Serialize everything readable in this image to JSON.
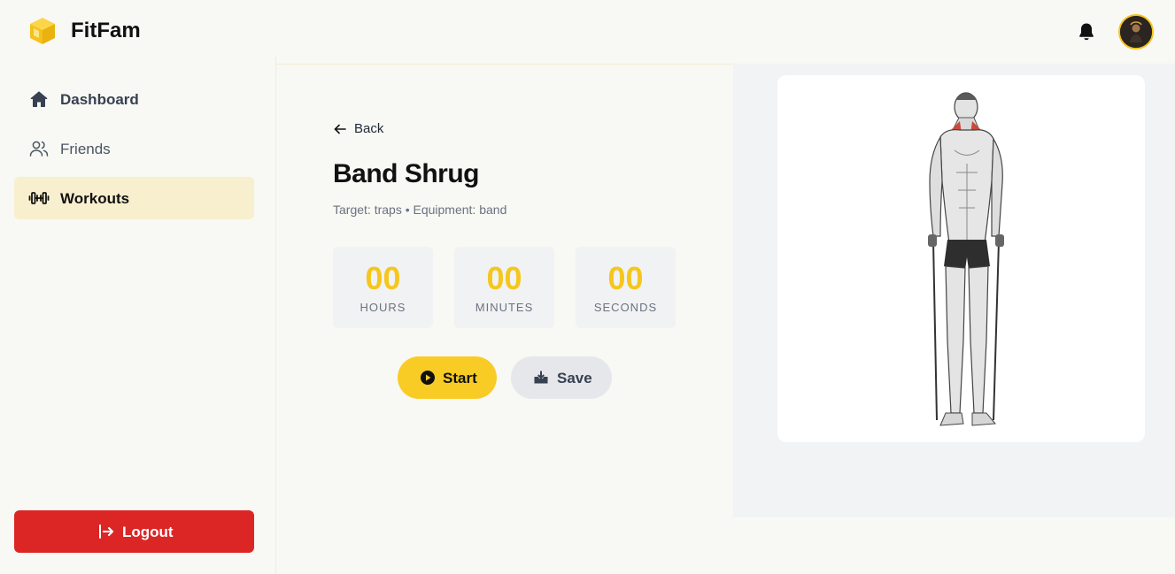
{
  "header": {
    "app_name": "FitFam",
    "brand_color": "#f6c31a",
    "icons": [
      "box-logo-icon",
      "bell-icon",
      "avatar"
    ]
  },
  "sidebar": {
    "items": [
      {
        "label": "Dashboard",
        "icon": "home-icon",
        "active": false
      },
      {
        "label": "Friends",
        "icon": "users-icon",
        "active": false
      },
      {
        "label": "Workouts",
        "icon": "dumbbell-icon",
        "active": true
      }
    ],
    "logout_label": "Logout",
    "logout_color": "#dc2626"
  },
  "exercise": {
    "back_label": "Back",
    "title": "Band Shrug",
    "subtitle": "Target: traps • Equipment: band"
  },
  "timer": {
    "hours": {
      "value": "00",
      "label": "HOURS"
    },
    "minutes": {
      "value": "00",
      "label": "MINUTES"
    },
    "seconds": {
      "value": "00",
      "label": "SECONDS"
    }
  },
  "actions": {
    "start_label": "Start",
    "save_label": "Save"
  },
  "image": {
    "alt": "band shrug illustration"
  }
}
